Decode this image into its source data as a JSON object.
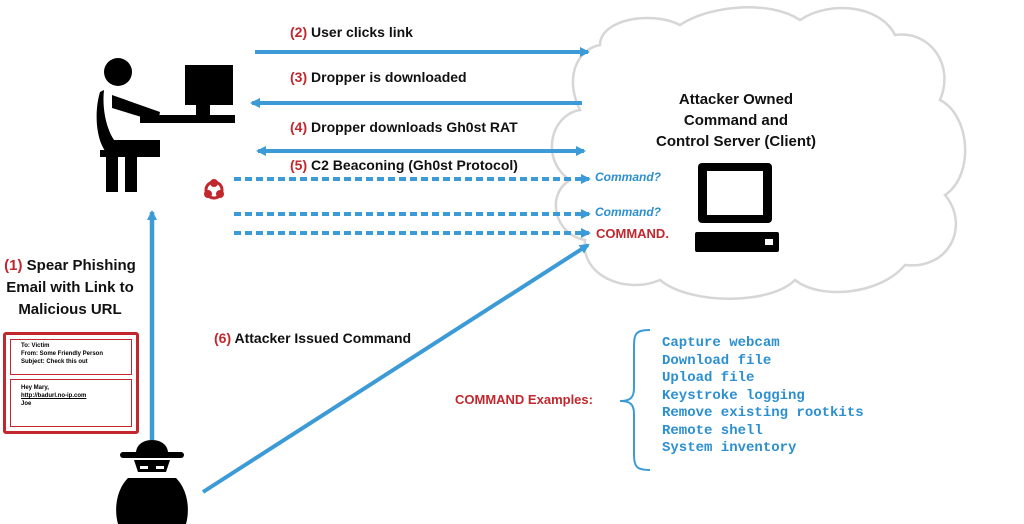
{
  "steps": {
    "s1_num": "(1)",
    "s1_text": [
      "Spear Phishing",
      "Email with Link to",
      "Malicious URL"
    ],
    "s2_num": "(2)",
    "s2_text": "User clicks link",
    "s3_num": "(3)",
    "s3_text": "Dropper is downloaded",
    "s4_num": "(4)",
    "s4_text": "Dropper downloads Gh0st RAT",
    "s5_num": "(5)",
    "s5_text": "C2 Beaconing (Gh0st Protocol)",
    "s6_num": "(6)",
    "s6_text": "Attacker Issued Command"
  },
  "server": {
    "title_lines": [
      "Attacker Owned",
      "Command and",
      "Control Server (Client)"
    ]
  },
  "beacons": {
    "command_q1": "Command?",
    "command_q2": "Command?",
    "command": "COMMAND."
  },
  "email": {
    "to": "To: Victim",
    "from": "From: Some Friendly Person",
    "subject": "Subject: Check this out",
    "greeting": "Hey Mary,",
    "link": "http://badurl.no-ip.com",
    "sign": "Joe"
  },
  "examples": {
    "label": "COMMAND Examples:",
    "items": [
      "Capture webcam",
      "Download file",
      "Upload file",
      "Keystroke logging",
      "Remove existing rootkits",
      "Remote shell",
      "System inventory"
    ]
  },
  "colors": {
    "arrow": "#3c9bd6",
    "red": "#c1272d",
    "cloud_stroke": "#d8d8d8",
    "mono_blue": "#2c8fd0"
  },
  "icons": [
    "user-at-computer-icon",
    "biohazard-icon",
    "server-computer-icon",
    "hacker-icon",
    "cloud-icon"
  ]
}
